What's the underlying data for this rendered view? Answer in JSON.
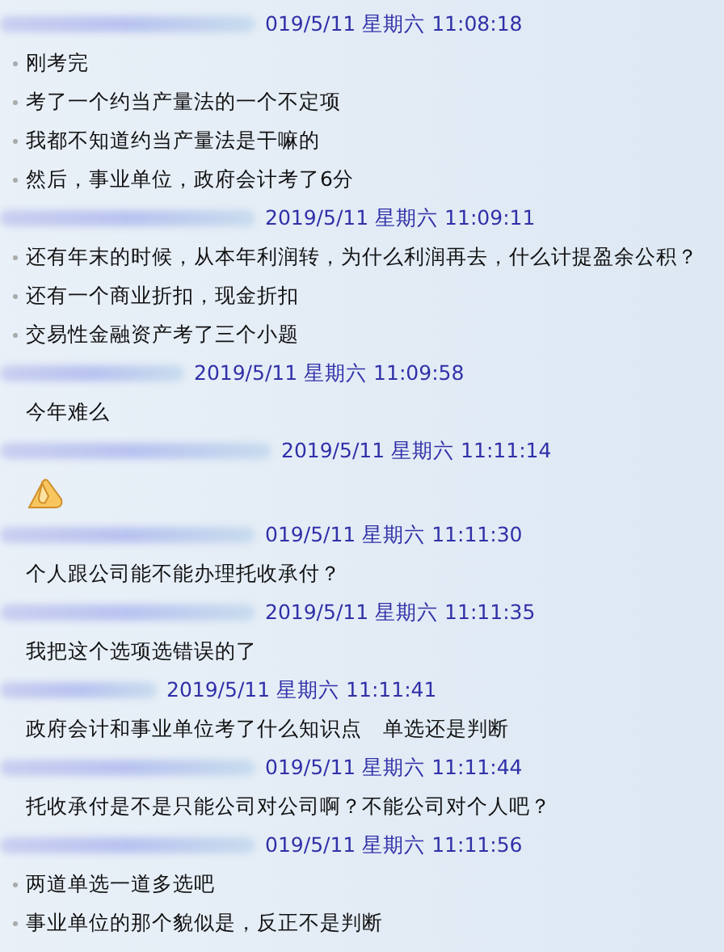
{
  "messages": [
    {
      "timestamp": "019/5/11 星期六 11:08:18",
      "bulleted": true,
      "lines": [
        {
          "kind": "text",
          "text": "刚考完"
        },
        {
          "kind": "text",
          "text": "考了一个约当产量法的一个不定项"
        },
        {
          "kind": "text",
          "text": "我都不知道约当产量法是干嘛的"
        },
        {
          "kind": "text",
          "text": "然后，事业单位，政府会计考了6分"
        }
      ]
    },
    {
      "timestamp": "2019/5/11 星期六 11:09:11",
      "bulleted": true,
      "lines": [
        {
          "kind": "text",
          "text": "还有年末的时候，从本年利润转，为什么利润再去，什么计提盈余公积？"
        },
        {
          "kind": "text",
          "text": "还有一个商业折扣，现金折扣"
        },
        {
          "kind": "text",
          "text": "交易性金融资产考了三个小题"
        }
      ]
    },
    {
      "timestamp": "2019/5/11 星期六 11:09:58",
      "bulleted": false,
      "lines": [
        {
          "kind": "text",
          "text": "今年难么"
        }
      ]
    },
    {
      "timestamp": "2019/5/11 星期六 11:11:14",
      "bulleted": false,
      "lines": [
        {
          "kind": "emoji"
        }
      ]
    },
    {
      "timestamp": "019/5/11 星期六 11:11:30",
      "bulleted": false,
      "lines": [
        {
          "kind": "text",
          "text": "个人跟公司能不能办理托收承付？"
        }
      ]
    },
    {
      "timestamp": "2019/5/11 星期六 11:11:35",
      "bulleted": false,
      "lines": [
        {
          "kind": "text",
          "text": "我把这个选项选错误的了"
        }
      ]
    },
    {
      "timestamp": "2019/5/11 星期六 11:11:41",
      "bulleted": false,
      "lines": [
        {
          "kind": "text",
          "text": "政府会计和事业单位考了什么知识点　单选还是判断"
        }
      ]
    },
    {
      "timestamp": "019/5/11 星期六 11:11:44",
      "bulleted": false,
      "lines": [
        {
          "kind": "text",
          "text": "托收承付是不是只能公司对公司啊？不能公司对个人吧？"
        }
      ]
    },
    {
      "timestamp": "019/5/11 星期六 11:11:56",
      "bulleted": true,
      "lines": [
        {
          "kind": "text",
          "text": "两道单选一道多选吧"
        },
        {
          "kind": "text",
          "text": "事业单位的那个貌似是，反正不是判断"
        }
      ]
    }
  ]
}
